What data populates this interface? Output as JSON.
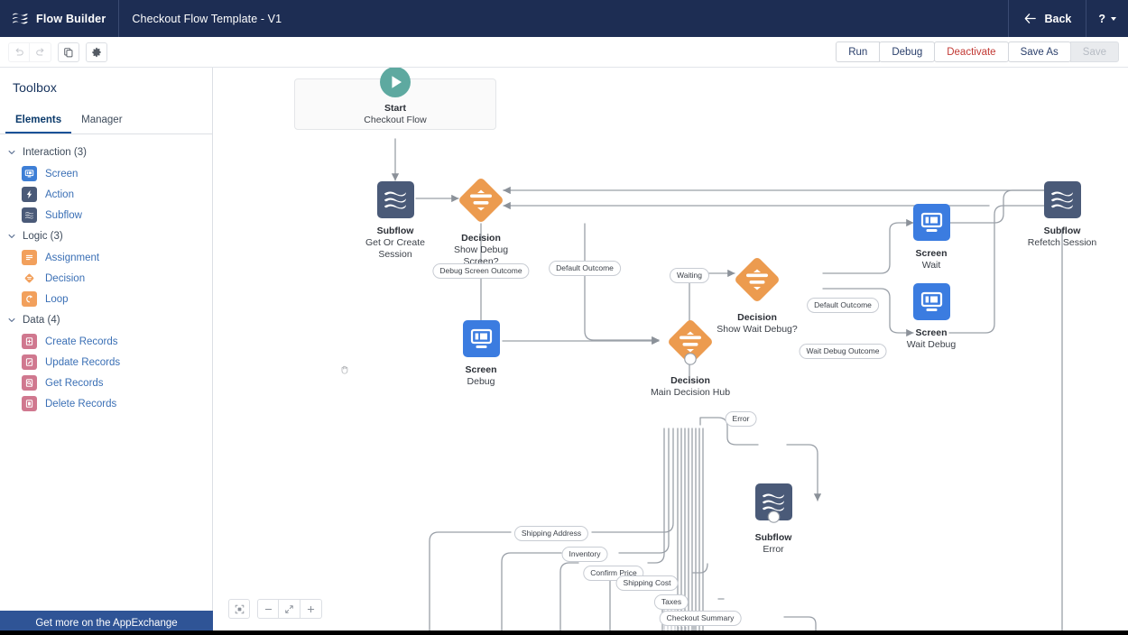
{
  "header": {
    "logo_icon": "flow-builder-logo-icon",
    "app_name": "Flow Builder",
    "flow_name": "Checkout Flow Template - V1",
    "back_label": "Back",
    "back_icon": "arrow-left-icon",
    "help_label": "?",
    "help_icon": "help-icon"
  },
  "toolbar": {
    "undo_icon": "undo-icon",
    "redo_icon": "redo-icon",
    "copy_icon": "copy-icon",
    "settings_icon": "gear-icon",
    "run_label": "Run",
    "debug_label": "Debug",
    "deactivate_label": "Deactivate",
    "save_as_label": "Save As",
    "save_label": "Save",
    "deactivate_color": "#c23934",
    "link_color": "#2a3f6b"
  },
  "sidebar": {
    "title": "Toolbox",
    "tabs": [
      {
        "label": "Elements",
        "active": true
      },
      {
        "label": "Manager",
        "active": false
      }
    ],
    "groups": [
      {
        "label": "Interaction (3)",
        "items": [
          {
            "label": "Screen",
            "icon": "screen-icon",
            "color": "#3e7fd6"
          },
          {
            "label": "Action",
            "icon": "action-bolt-icon",
            "color": "#4a5a78"
          },
          {
            "label": "Subflow",
            "icon": "subflow-icon",
            "color": "#4a5a78"
          }
        ]
      },
      {
        "label": "Logic (3)",
        "items": [
          {
            "label": "Assignment",
            "icon": "assignment-icon",
            "color": "#f2a05c"
          },
          {
            "label": "Decision",
            "icon": "decision-diamond-icon",
            "color": "#f2a05c"
          },
          {
            "label": "Loop",
            "icon": "loop-icon",
            "color": "#f2a05c"
          }
        ]
      },
      {
        "label": "Data (4)",
        "items": [
          {
            "label": "Create Records",
            "icon": "create-records-icon",
            "color": "#d0788f"
          },
          {
            "label": "Update Records",
            "icon": "update-records-icon",
            "color": "#d0788f"
          },
          {
            "label": "Get Records",
            "icon": "get-records-icon",
            "color": "#d0788f"
          },
          {
            "label": "Delete Records",
            "icon": "delete-records-icon",
            "color": "#d0788f"
          }
        ]
      }
    ],
    "appexchange_label": "Get more on the AppExchange"
  },
  "canvas": {
    "cursor_icon": "grab-hand-cursor-icon",
    "nodes": [
      {
        "id": "start",
        "type": "start",
        "title": "Start",
        "subtitle": "Checkout Flow",
        "icon": "play-circle-icon",
        "color": "#5ea9a0"
      },
      {
        "id": "subflow_session",
        "type": "subflow",
        "title": "Subflow",
        "subtitle": "Get Or Create Session",
        "icon": "subflow-icon",
        "color": "#4a5a78"
      },
      {
        "id": "decision_debug",
        "type": "decision",
        "title": "Decision",
        "subtitle": "Show Debug Screen?",
        "icon": "decision-diamond-icon",
        "color": "#ec9b4f"
      },
      {
        "id": "screen_debug",
        "type": "screen",
        "title": "Screen",
        "subtitle": "Debug",
        "icon": "screen-icon",
        "color": "#3b7ce0"
      },
      {
        "id": "decision_main",
        "type": "decision",
        "title": "Decision",
        "subtitle": "Main Decision Hub",
        "icon": "decision-diamond-icon",
        "color": "#ec9b4f"
      },
      {
        "id": "decision_wait_debug",
        "type": "decision",
        "title": "Decision",
        "subtitle": "Show Wait Debug?",
        "icon": "decision-diamond-icon",
        "color": "#ec9b4f"
      },
      {
        "id": "screen_wait",
        "type": "screen",
        "title": "Screen",
        "subtitle": "Wait",
        "icon": "screen-icon",
        "color": "#3b7ce0"
      },
      {
        "id": "screen_wait_debug",
        "type": "screen",
        "title": "Screen",
        "subtitle": "Wait Debug",
        "icon": "screen-icon",
        "color": "#3b7ce0"
      },
      {
        "id": "subflow_refetch",
        "type": "subflow",
        "title": "Subflow",
        "subtitle": "Refetch Session",
        "icon": "subflow-icon",
        "color": "#4a5a78"
      },
      {
        "id": "subflow_error",
        "type": "subflow",
        "title": "Subflow",
        "subtitle": "Error",
        "icon": "subflow-icon",
        "color": "#4a5a78"
      }
    ],
    "connector_labels": [
      {
        "id": "debug_screen_outcome",
        "text": "Debug Screen Outcome"
      },
      {
        "id": "default_outcome_1",
        "text": "Default Outcome"
      },
      {
        "id": "waiting",
        "text": "Waiting"
      },
      {
        "id": "default_outcome_2",
        "text": "Default Outcome"
      },
      {
        "id": "wait_debug_outcome",
        "text": "Wait Debug Outcome"
      },
      {
        "id": "error",
        "text": "Error"
      },
      {
        "id": "shipping_address",
        "text": "Shipping Address"
      },
      {
        "id": "inventory",
        "text": "Inventory"
      },
      {
        "id": "confirm_price",
        "text": "Confirm Price"
      },
      {
        "id": "shipping_cost",
        "text": "Shipping Cost"
      },
      {
        "id": "taxes",
        "text": "Taxes"
      },
      {
        "id": "checkout_summary",
        "text": "Checkout Summary"
      }
    ]
  },
  "zoom_controls": {
    "fit_icon": "fit-to-view-icon",
    "zoom_out_icon": "minus-icon",
    "zoom_reset_icon": "zoom-reset-icon",
    "zoom_in_icon": "plus-icon"
  }
}
